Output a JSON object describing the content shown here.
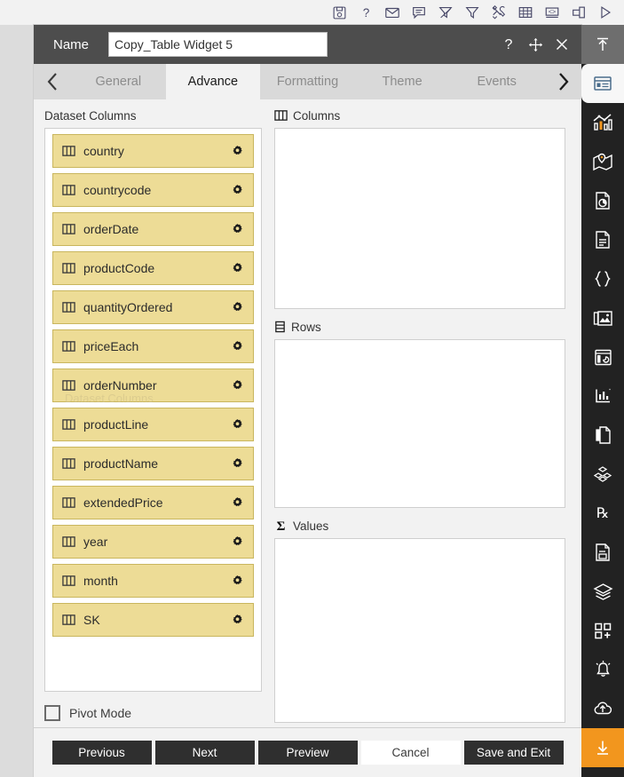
{
  "toolbar": {
    "icons": [
      {
        "name": "save-icon",
        "title": "Save"
      },
      {
        "name": "help-icon",
        "title": "Help"
      },
      {
        "name": "mail-icon",
        "title": "Mail"
      },
      {
        "name": "comment-icon",
        "title": "Comment"
      },
      {
        "name": "clear-filter-icon",
        "title": "Clear Filter"
      },
      {
        "name": "filter-icon",
        "title": "Filter"
      },
      {
        "name": "tools-icon",
        "title": "Tools"
      },
      {
        "name": "grid-icon",
        "title": "Grid"
      },
      {
        "name": "code-icon",
        "title": "Code"
      },
      {
        "name": "duplicate-icon",
        "title": "Duplicate"
      },
      {
        "name": "run-icon",
        "title": "Run"
      }
    ]
  },
  "dialog": {
    "name_label": "Name",
    "name_value": "Copy_Table Widget 5",
    "name_placeholder": "Copy_Table Widget 5",
    "header_actions": [
      {
        "name": "help-icon",
        "glyph": "?"
      },
      {
        "name": "move-icon",
        "glyph": "✥"
      },
      {
        "name": "close-icon",
        "glyph": "✕"
      }
    ],
    "tabs": [
      {
        "label": "General",
        "active": false
      },
      {
        "label": "Advance",
        "active": true
      },
      {
        "label": "Formatting",
        "active": false
      },
      {
        "label": "Theme",
        "active": false
      },
      {
        "label": "Events",
        "active": false
      }
    ],
    "tab_prev_label": "‹",
    "tab_next_label": "›"
  },
  "left_panel": {
    "title": "Dataset Columns",
    "ghost_text": "Dataset Columns",
    "columns": [
      {
        "name": "country"
      },
      {
        "name": "countrycode"
      },
      {
        "name": "orderDate"
      },
      {
        "name": "productCode"
      },
      {
        "name": "quantityOrdered"
      },
      {
        "name": "priceEach"
      },
      {
        "name": "orderNumber"
      },
      {
        "name": "productLine"
      },
      {
        "name": "productName"
      },
      {
        "name": "extendedPrice"
      },
      {
        "name": "year"
      },
      {
        "name": "month"
      },
      {
        "name": "SK"
      }
    ],
    "pivot_mode_label": "Pivot Mode",
    "pivot_mode_checked": false
  },
  "right_panel": {
    "zones": [
      {
        "title": "Columns",
        "icon": "columns-icon",
        "items": []
      },
      {
        "title": "Rows",
        "icon": "rows-icon",
        "items": []
      },
      {
        "title": "Values",
        "icon": "sigma-icon",
        "items": []
      }
    ]
  },
  "footer": {
    "buttons": [
      {
        "label": "Previous",
        "style": "dark"
      },
      {
        "label": "Next",
        "style": "dark"
      },
      {
        "label": "Preview",
        "style": "dark"
      },
      {
        "label": "Cancel",
        "style": "light"
      },
      {
        "label": "Save and Exit",
        "style": "dark"
      }
    ]
  },
  "sidebar": {
    "items": [
      {
        "name": "collapse-up-icon",
        "state": "top-grey"
      },
      {
        "name": "widget-panel-icon",
        "state": "active-white"
      },
      {
        "name": "chart-icon",
        "state": "normal"
      },
      {
        "name": "map-icon",
        "state": "normal"
      },
      {
        "name": "report-pie-icon",
        "state": "normal"
      },
      {
        "name": "document-icon",
        "state": "normal"
      },
      {
        "name": "braces-icon",
        "state": "normal"
      },
      {
        "name": "images-icon",
        "state": "normal"
      },
      {
        "name": "dashboard-card-icon",
        "state": "normal"
      },
      {
        "name": "analytics-icon",
        "state": "normal"
      },
      {
        "name": "copy-page-icon",
        "state": "normal"
      },
      {
        "name": "cubes-icon",
        "state": "normal"
      },
      {
        "name": "rx-icon",
        "state": "normal"
      },
      {
        "name": "file-save-icon",
        "state": "normal"
      },
      {
        "name": "layers-icon",
        "state": "normal"
      },
      {
        "name": "add-widget-icon",
        "state": "normal"
      },
      {
        "name": "alert-bell-icon",
        "state": "normal"
      },
      {
        "name": "cloud-upload-icon",
        "state": "normal"
      },
      {
        "name": "download-icon",
        "state": "orange"
      }
    ]
  },
  "colors": {
    "accent_orange": "#f2961e",
    "column_chip": "#eddc96",
    "column_chip_border": "#c9b65e",
    "header_bg": "#4d4d4d",
    "sidebar_bg": "#222222",
    "button_dark": "#2f2f2f"
  }
}
